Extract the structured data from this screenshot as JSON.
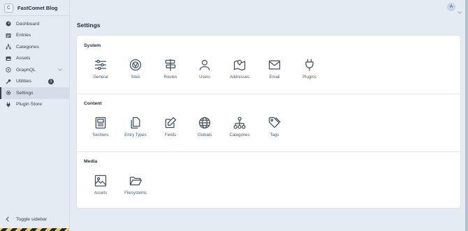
{
  "site": {
    "badge": "C",
    "name": "FastComet Blog"
  },
  "sidebar": {
    "items": [
      {
        "label": "Dashboard",
        "icon": "dashboard-icon"
      },
      {
        "label": "Entries",
        "icon": "entries-icon"
      },
      {
        "label": "Categories",
        "icon": "categories-icon"
      },
      {
        "label": "Assets",
        "icon": "assets-icon"
      },
      {
        "label": "GraphQL",
        "icon": "graphql-icon",
        "expandable": true
      },
      {
        "label": "Utilities",
        "icon": "utilities-icon",
        "badge": "1"
      },
      {
        "label": "Settings",
        "icon": "gear-icon",
        "active": true
      },
      {
        "label": "Plugin Store",
        "icon": "plug-icon"
      }
    ],
    "toggle_label": "Toggle sidebar"
  },
  "user": {
    "avatar_letter": "A"
  },
  "main": {
    "title": "Settings",
    "sections": [
      {
        "title": "System",
        "items": [
          "General",
          "Sites",
          "Routes",
          "Users",
          "Addresses",
          "Email",
          "Plugins"
        ]
      },
      {
        "title": "Content",
        "items": [
          "Sections",
          "Entry Types",
          "Fields",
          "Globals",
          "Categories",
          "Tags"
        ]
      },
      {
        "title": "Media",
        "items": [
          "Assets",
          "Filesystems"
        ]
      }
    ]
  },
  "colors": {
    "accent": "#3f4d5a",
    "background": "#e4ebf3",
    "panel": "#ffffff"
  }
}
